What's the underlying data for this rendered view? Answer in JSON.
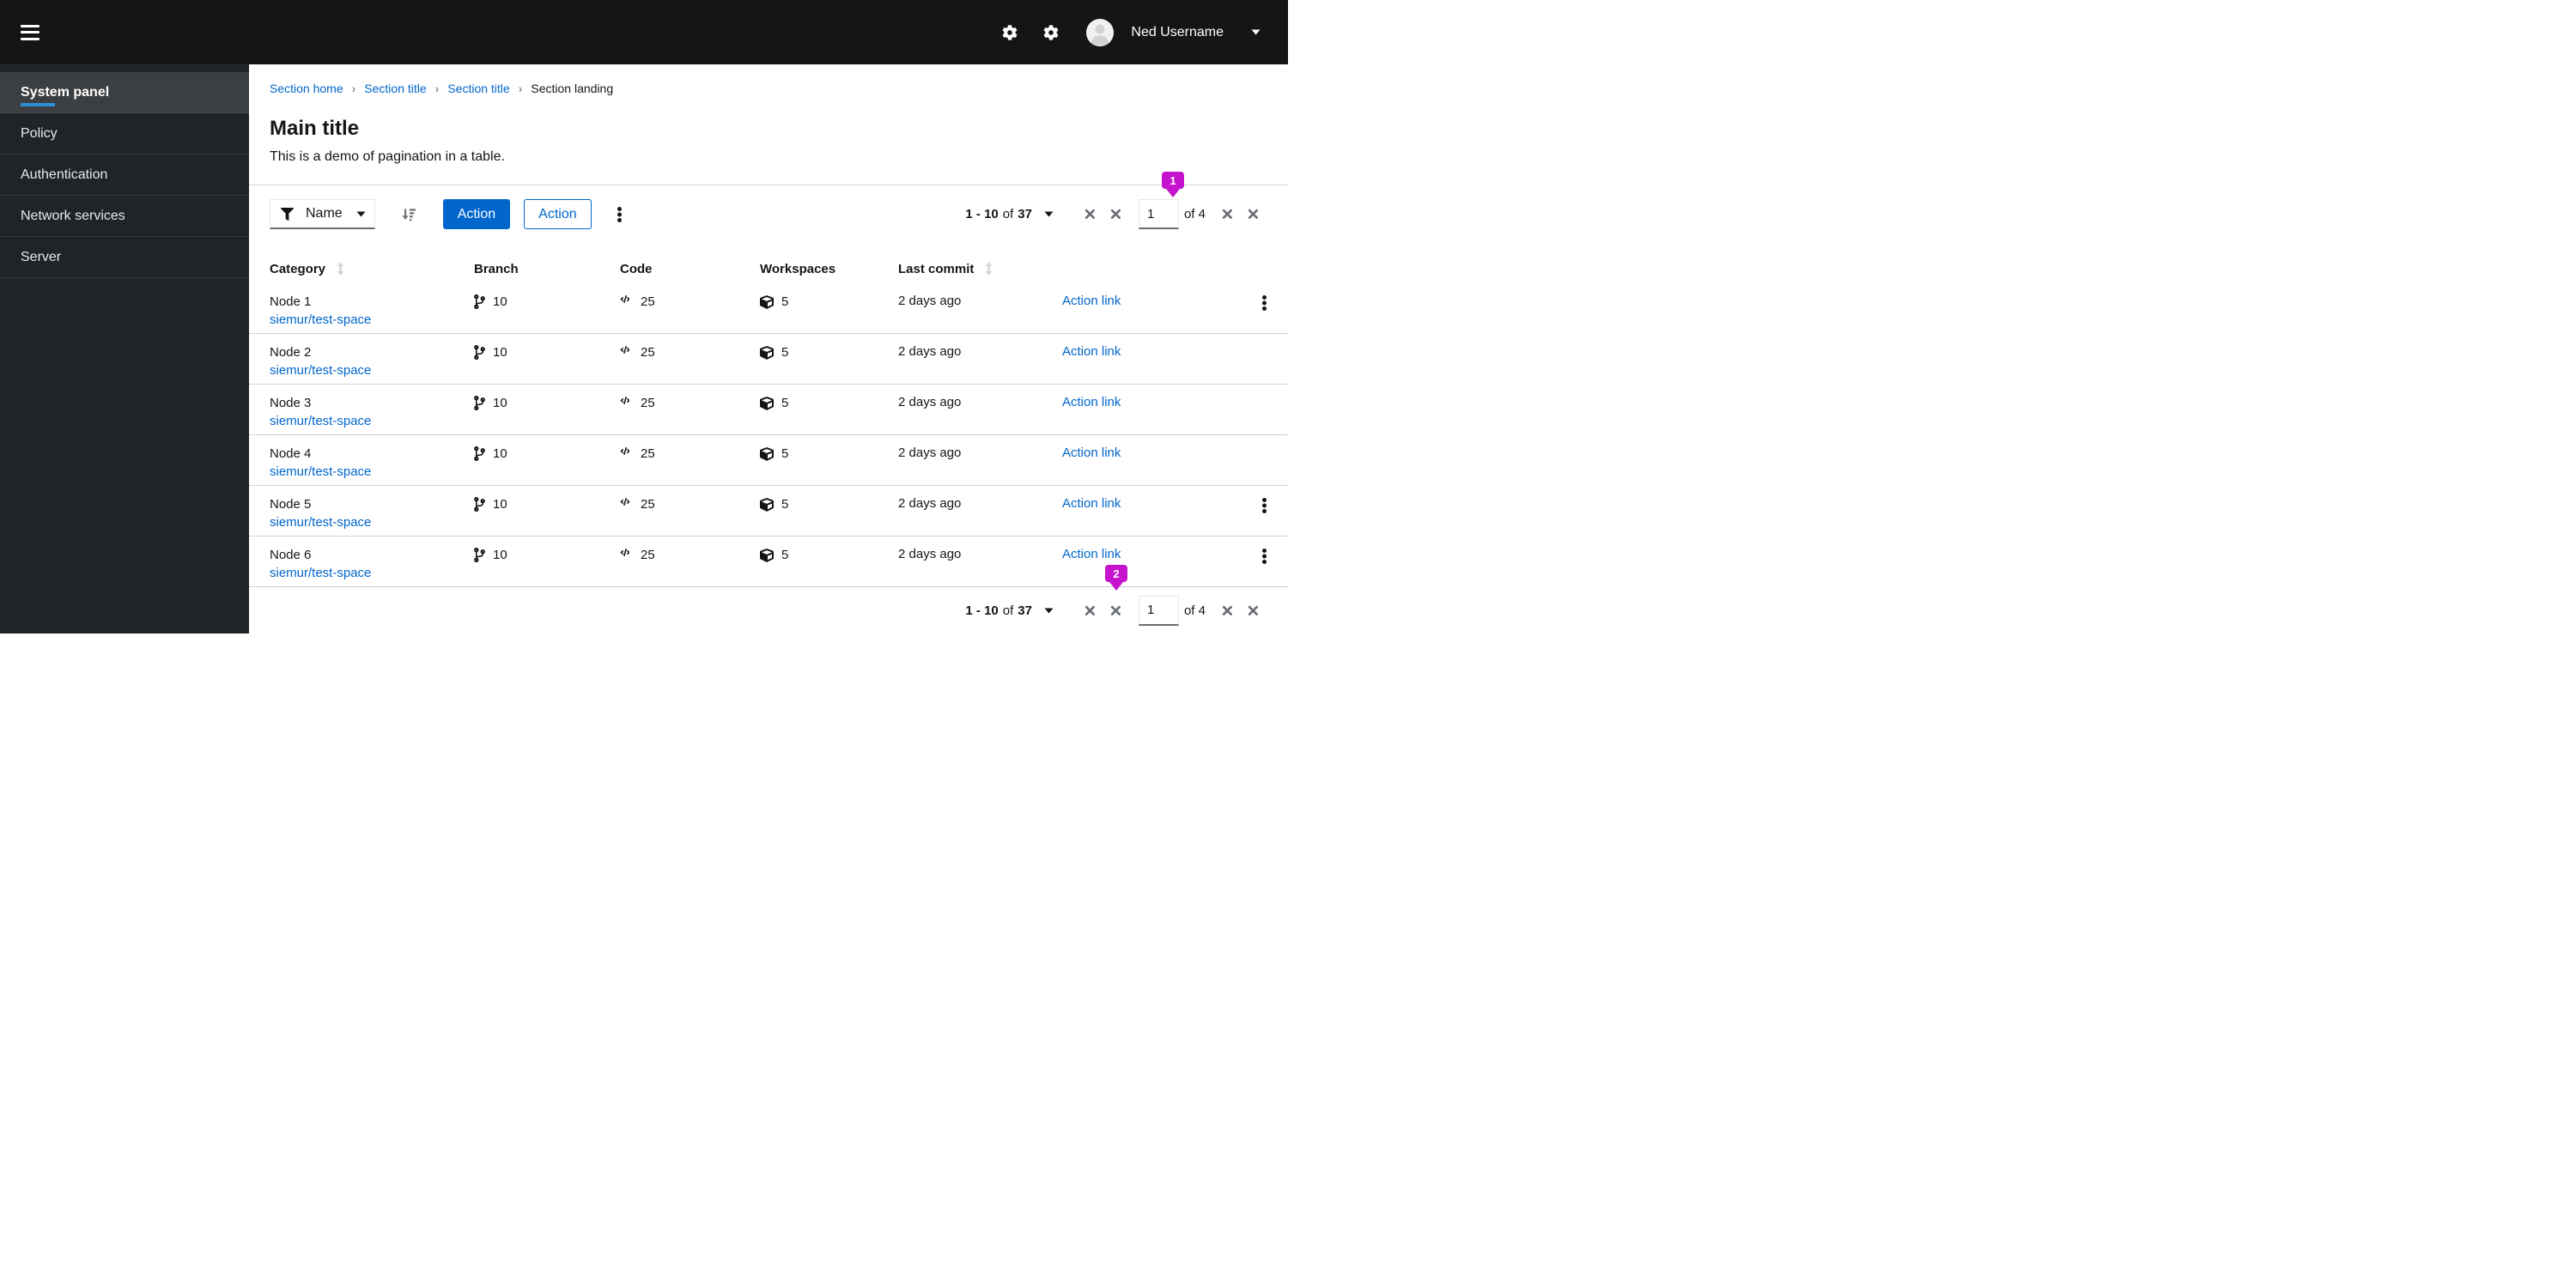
{
  "masthead": {
    "username": "Ned Username"
  },
  "sidebar": {
    "items": [
      {
        "label": "System panel",
        "active": true
      },
      {
        "label": "Policy",
        "active": false
      },
      {
        "label": "Authentication",
        "active": false
      },
      {
        "label": "Network services",
        "active": false
      },
      {
        "label": "Server",
        "active": false
      }
    ]
  },
  "breadcrumb": {
    "separator": "›",
    "items": [
      {
        "label": "Section home"
      },
      {
        "label": "Section title"
      },
      {
        "label": "Section title"
      },
      {
        "label": "Section landing"
      }
    ]
  },
  "page": {
    "title": "Main title",
    "subtitle": "This is a demo of pagination in a table."
  },
  "toolbar": {
    "filter_label": "Name",
    "primary_action": "Action",
    "secondary_action": "Action"
  },
  "pagination": {
    "range": "1 - 10",
    "of_word": "of",
    "total": "37",
    "current_page": "1",
    "page_count": "of 4"
  },
  "annotations": {
    "badge1": "1",
    "badge2": "2"
  },
  "table": {
    "headers": [
      {
        "label": "Category",
        "sortable": true
      },
      {
        "label": "Branch",
        "sortable": false
      },
      {
        "label": "Code",
        "sortable": false
      },
      {
        "label": "Workspaces",
        "sortable": false
      },
      {
        "label": "Last commit",
        "sortable": true
      }
    ],
    "rows": [
      {
        "name": "Node 1",
        "link": "siemur/test-space",
        "branch": "10",
        "code": "25",
        "workspaces": "5",
        "last_commit": "2 days ago",
        "action": "Action link",
        "kebab": true
      },
      {
        "name": "Node 2",
        "link": "siemur/test-space",
        "branch": "10",
        "code": "25",
        "workspaces": "5",
        "last_commit": "2 days ago",
        "action": "Action link",
        "kebab": false
      },
      {
        "name": "Node 3",
        "link": "siemur/test-space",
        "branch": "10",
        "code": "25",
        "workspaces": "5",
        "last_commit": "2 days ago",
        "action": "Action link",
        "kebab": false
      },
      {
        "name": "Node 4",
        "link": "siemur/test-space",
        "branch": "10",
        "code": "25",
        "workspaces": "5",
        "last_commit": "2 days ago",
        "action": "Action link",
        "kebab": false
      },
      {
        "name": "Node 5",
        "link": "siemur/test-space",
        "branch": "10",
        "code": "25",
        "workspaces": "5",
        "last_commit": "2 days ago",
        "action": "Action link",
        "kebab": true
      },
      {
        "name": "Node 6",
        "link": "siemur/test-space",
        "branch": "10",
        "code": "25",
        "workspaces": "5",
        "last_commit": "2 days ago",
        "action": "Action link",
        "kebab": true
      }
    ]
  },
  "icons": {
    "menu": "hamburger-icon",
    "settings": "gear-icon",
    "user": "avatar-icon",
    "dropdown": "caret-down-icon",
    "filter": "filter-funnel-icon",
    "sort": "sort-amount-down-icon",
    "overflow": "kebab-icon",
    "pagination_nav": "close-x-icon",
    "column_sort": "arrows-vertical-icon",
    "branch": "code-branch-icon",
    "code": "code-icon",
    "workspaces": "cube-icon"
  },
  "colors": {
    "primary": "#0066cc",
    "link": "#0066cc",
    "badge": "#c614ce",
    "nav_active_underline": "#2b8fd8",
    "masthead_bg": "#151515",
    "sidebar_bg": "#212427",
    "sidebar_active_bg": "#3c3f42",
    "divider": "#d2d2d2",
    "icon_grey": "#6a6e73"
  }
}
